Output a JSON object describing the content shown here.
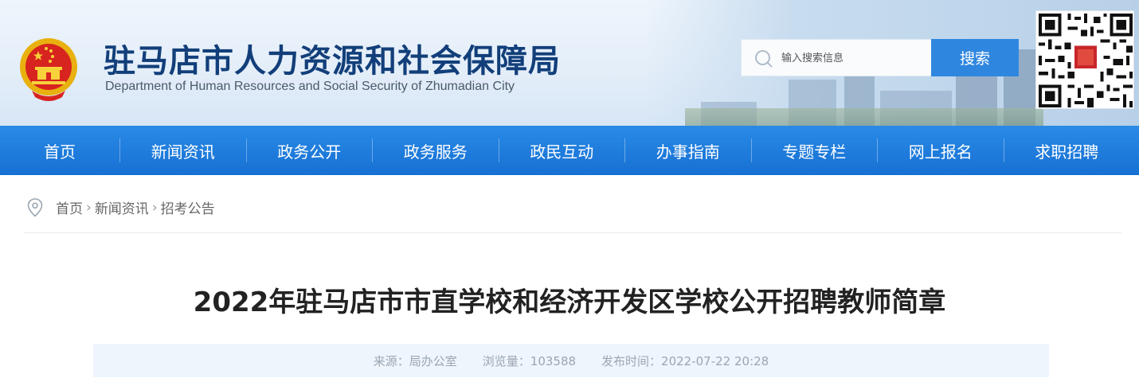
{
  "header": {
    "title": "驻马店市人力资源和社会保障局",
    "subtitle": "Department of Human Resources and Social Security of Zhumadian City",
    "emblem_icon": "national-emblem-icon",
    "qr_icon": "qr-code-icon"
  },
  "search": {
    "placeholder": "输入搜索信息",
    "button_label": "搜索"
  },
  "nav": {
    "items": [
      {
        "label": "首页"
      },
      {
        "label": "新闻资讯"
      },
      {
        "label": "政务公开"
      },
      {
        "label": "政务服务"
      },
      {
        "label": "政民互动"
      },
      {
        "label": "办事指南"
      },
      {
        "label": "专题专栏"
      },
      {
        "label": "网上报名"
      },
      {
        "label": "求职招聘"
      }
    ]
  },
  "breadcrumb": {
    "icon": "location-pin-icon",
    "items": [
      "首页",
      "新闻资讯",
      "招考公告"
    ]
  },
  "article": {
    "title": "2022年驻马店市市直学校和经济开发区学校公开招聘教师简章",
    "source": "来源：局办公室",
    "views": "浏览量：103588",
    "published": "发布时间：2022-07-22 20:28"
  },
  "colors": {
    "brand_blue": "#1670d3",
    "title_blue": "#123f7a",
    "search_button": "#2f86df",
    "meta_bg": "#eef5fc"
  }
}
